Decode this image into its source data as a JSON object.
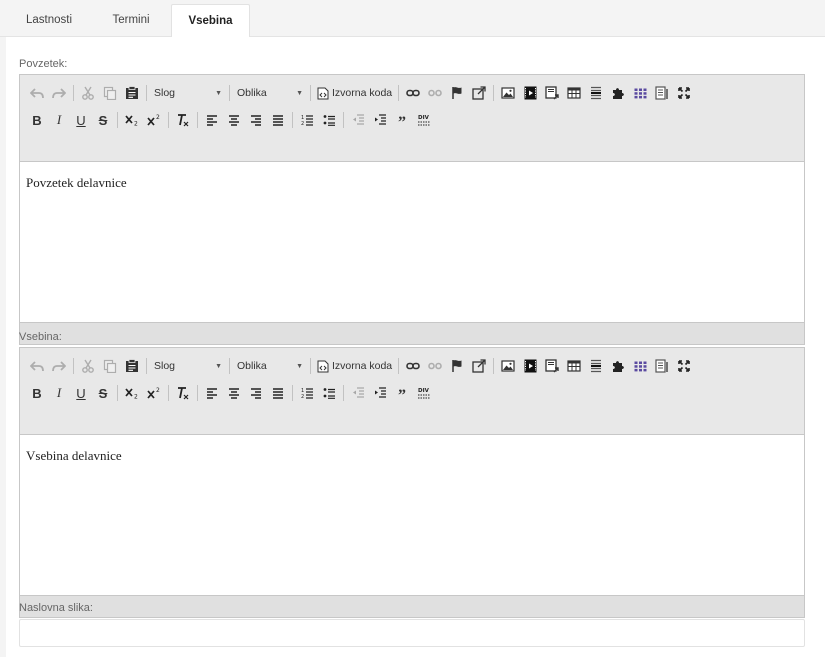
{
  "tabs": [
    {
      "label": "Lastnosti"
    },
    {
      "label": "Termini"
    },
    {
      "label": "Vsebina"
    }
  ],
  "active_tab": "Vsebina",
  "fields": {
    "summary_label": "Povzetek:",
    "content_label": "Vsebina:",
    "cover_label": "Naslovna slika:",
    "cover_value": ""
  },
  "toolbar": {
    "style_combo": "Slog",
    "format_combo": "Oblika",
    "source_label": "Izvorna koda"
  },
  "editors": [
    {
      "text": "Povzetek delavnice"
    },
    {
      "text": "Vsebina delavnice"
    }
  ],
  "colors": {
    "toolbar_bg": "#e8e8e8",
    "border": "#c7c7c7",
    "active_tab_bg": "#ffffff",
    "page_bg": "#f4f4f4"
  }
}
